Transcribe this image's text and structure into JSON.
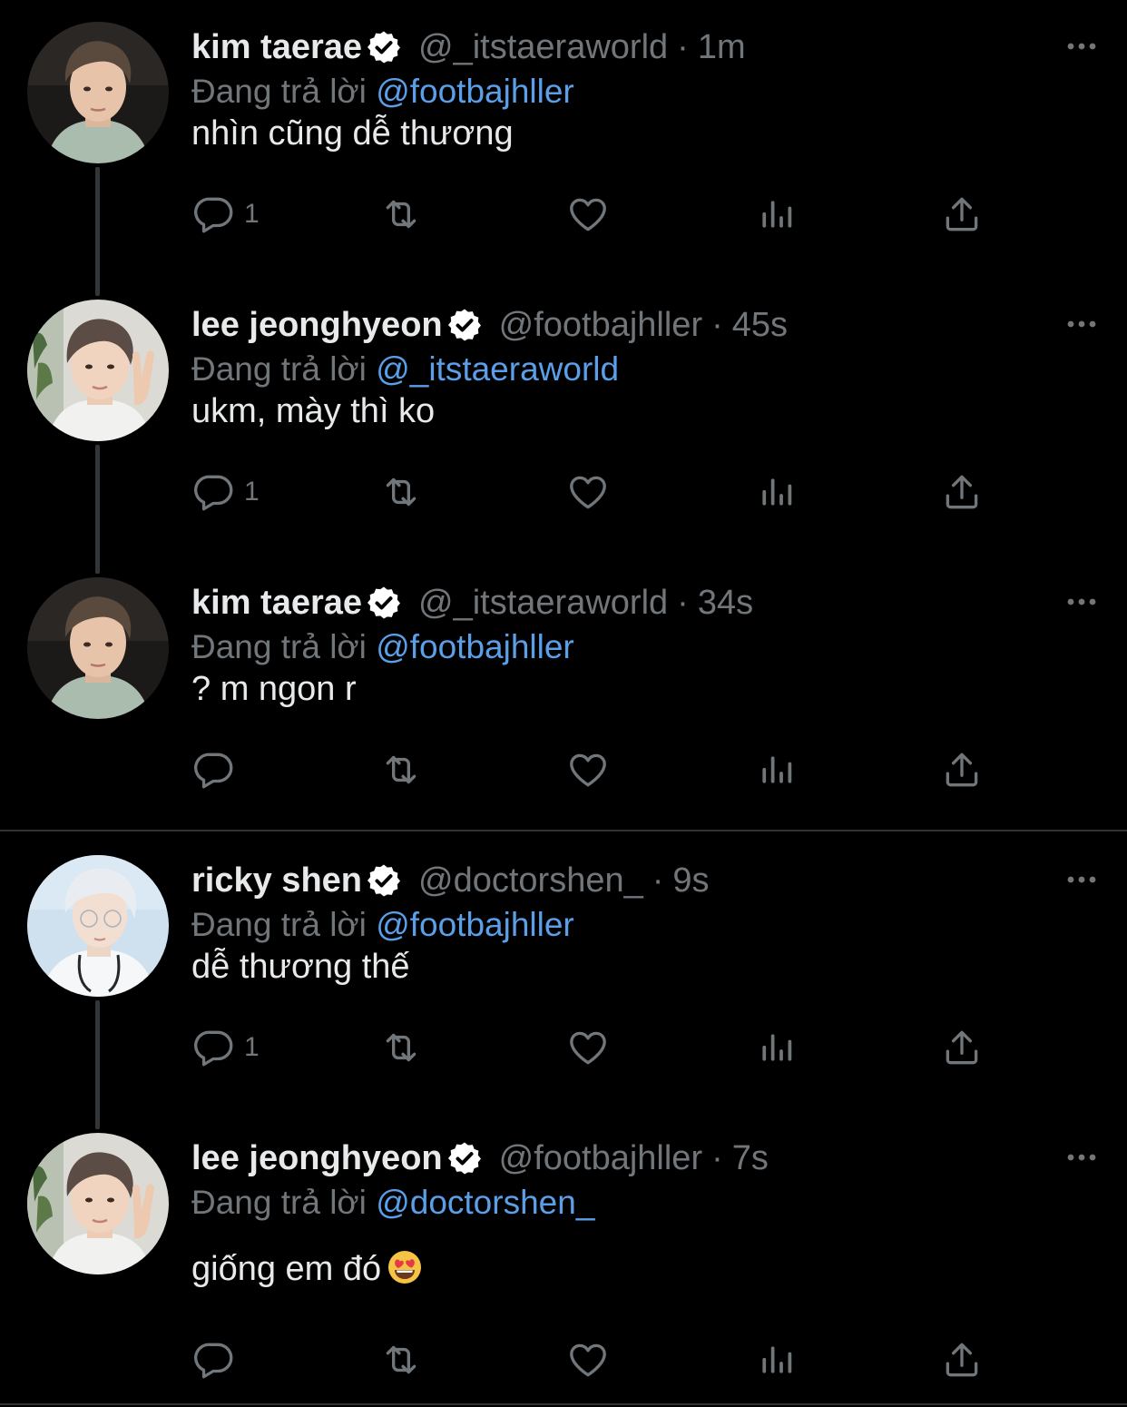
{
  "reply_prefix": "Đang trả lời",
  "colors": {
    "background": "#000000",
    "mention": "#5a9fe8",
    "muted": "#71767b",
    "verified": "#ffffff"
  },
  "tweets": [
    {
      "name": "kim taerae",
      "handle": "@_itstaeraworld",
      "separator": "·",
      "time": "1m",
      "reply_to": "@footbajhller",
      "text": "nhìn cũng dễ thương",
      "reply_count": "1",
      "avatar": "avatar-kim-taerae"
    },
    {
      "name": "lee jeonghyeon",
      "handle": "@footbajhller",
      "separator": "·",
      "time": "45s",
      "reply_to": "@_itstaeraworld",
      "text": "ukm, mày thì ko",
      "reply_count": "1",
      "avatar": "avatar-lee-jeonghyeon"
    },
    {
      "name": "kim taerae",
      "handle": "@_itstaeraworld",
      "separator": "·",
      "time": "34s",
      "reply_to": "@footbajhller",
      "text": "? m ngon r",
      "reply_count": "",
      "avatar": "avatar-kim-taerae"
    },
    {
      "name": "ricky shen",
      "handle": "@doctorshen_",
      "separator": "·",
      "time": "9s",
      "reply_to": "@footbajhller",
      "text": "dễ thương thế",
      "reply_count": "1",
      "avatar": "avatar-ricky-shen"
    },
    {
      "name": "lee jeonghyeon",
      "handle": "@footbajhller",
      "separator": "·",
      "time": "7s",
      "reply_to": "@doctorshen_",
      "text": "giống em đó",
      "reply_count": "",
      "avatar": "avatar-lee-jeonghyeon",
      "emoji": "heart-eyes-emoji"
    }
  ],
  "icons": [
    "reply-icon",
    "retweet-icon",
    "like-icon",
    "views-icon",
    "share-icon",
    "more-icon",
    "verified-icon"
  ]
}
